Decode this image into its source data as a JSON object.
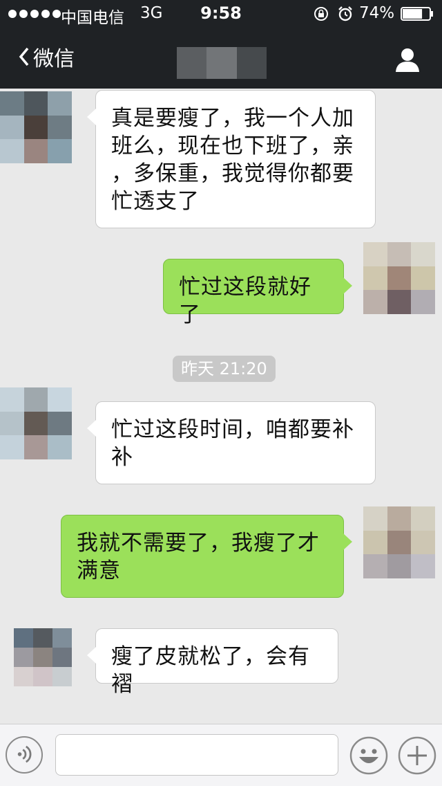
{
  "status_bar": {
    "carrier": "中国电信",
    "network": "3G",
    "time": "9:58",
    "battery": "74%",
    "battery_level": 0.74
  },
  "nav": {
    "back_label": "微信",
    "icons": {
      "back": "chevron-left-icon",
      "contact": "person-icon"
    }
  },
  "messages": [
    {
      "side": "left",
      "text_lines": [
        "真是要瘦了，我一个人加",
        "班么，现在也下班了，亲",
        "，多保重，我觉得你都要",
        "忙透支了"
      ]
    },
    {
      "side": "right",
      "text_lines": [
        "忙过这段就好了"
      ]
    },
    {
      "side": "left",
      "text_lines": [
        "忙过这段时间，咱都要补",
        "补"
      ]
    },
    {
      "side": "right",
      "text_lines": [
        "我就不需要了，我瘦了才",
        "满意"
      ]
    },
    {
      "side": "left",
      "text_lines": [
        "瘦了皮就松了，会有褶"
      ]
    }
  ],
  "timestamp": "昨天 21:20",
  "input_bar": {
    "icons": {
      "voice": "voice-icon",
      "emoji": "emoji-icon",
      "more": "plus-icon"
    },
    "value": ""
  },
  "colors": {
    "header_bg": "#1f2225",
    "chat_bg": "#e9e9e9",
    "bubble_left": "#ffffff",
    "bubble_right": "#9be05a"
  }
}
